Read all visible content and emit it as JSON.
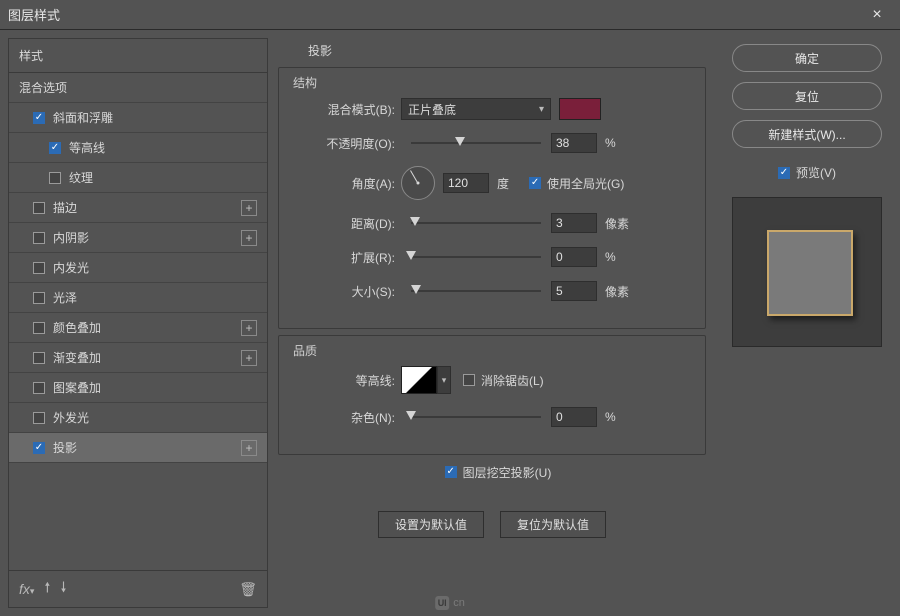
{
  "window": {
    "title": "图层样式"
  },
  "sidebar": {
    "header": "样式",
    "sub": "混合选项",
    "items": [
      {
        "label": "斜面和浮雕",
        "checked": true,
        "add": false,
        "indent": 1
      },
      {
        "label": "等高线",
        "checked": true,
        "add": false,
        "indent": 2
      },
      {
        "label": "纹理",
        "checked": false,
        "add": false,
        "indent": 2
      },
      {
        "label": "描边",
        "checked": false,
        "add": true,
        "indent": 1
      },
      {
        "label": "内阴影",
        "checked": false,
        "add": true,
        "indent": 1
      },
      {
        "label": "内发光",
        "checked": false,
        "add": false,
        "indent": 1
      },
      {
        "label": "光泽",
        "checked": false,
        "add": false,
        "indent": 1
      },
      {
        "label": "颜色叠加",
        "checked": false,
        "add": true,
        "indent": 1
      },
      {
        "label": "渐变叠加",
        "checked": false,
        "add": true,
        "indent": 1
      },
      {
        "label": "图案叠加",
        "checked": false,
        "add": false,
        "indent": 1
      },
      {
        "label": "外发光",
        "checked": false,
        "add": false,
        "indent": 1
      },
      {
        "label": "投影",
        "checked": true,
        "add": true,
        "indent": 1,
        "selected": true
      }
    ]
  },
  "main": {
    "title": "投影",
    "structure": {
      "legend": "结构",
      "blend_label": "混合模式(B):",
      "blend_value": "正片叠底",
      "opacity_label": "不透明度(O):",
      "opacity_value": "38",
      "opacity_unit": "%",
      "angle_label": "角度(A):",
      "angle_value": "120",
      "angle_unit": "度",
      "global_light_label": "使用全局光(G)",
      "distance_label": "距离(D):",
      "distance_value": "3",
      "distance_unit": "像素",
      "spread_label": "扩展(R):",
      "spread_value": "0",
      "spread_unit": "%",
      "size_label": "大小(S):",
      "size_value": "5",
      "size_unit": "像素"
    },
    "quality": {
      "legend": "品质",
      "contour_label": "等高线:",
      "antialias_label": "消除锯齿(L)",
      "noise_label": "杂色(N):",
      "noise_value": "0",
      "noise_unit": "%"
    },
    "knockout_label": "图层挖空投影(U)",
    "btn_default": "设置为默认值",
    "btn_reset": "复位为默认值"
  },
  "right": {
    "ok": "确定",
    "cancel": "复位",
    "newstyle": "新建样式(W)...",
    "preview": "预览(V)"
  },
  "watermark": {
    "logo": "UI",
    "text": "cn"
  },
  "footer": {
    "fx": "fx"
  }
}
